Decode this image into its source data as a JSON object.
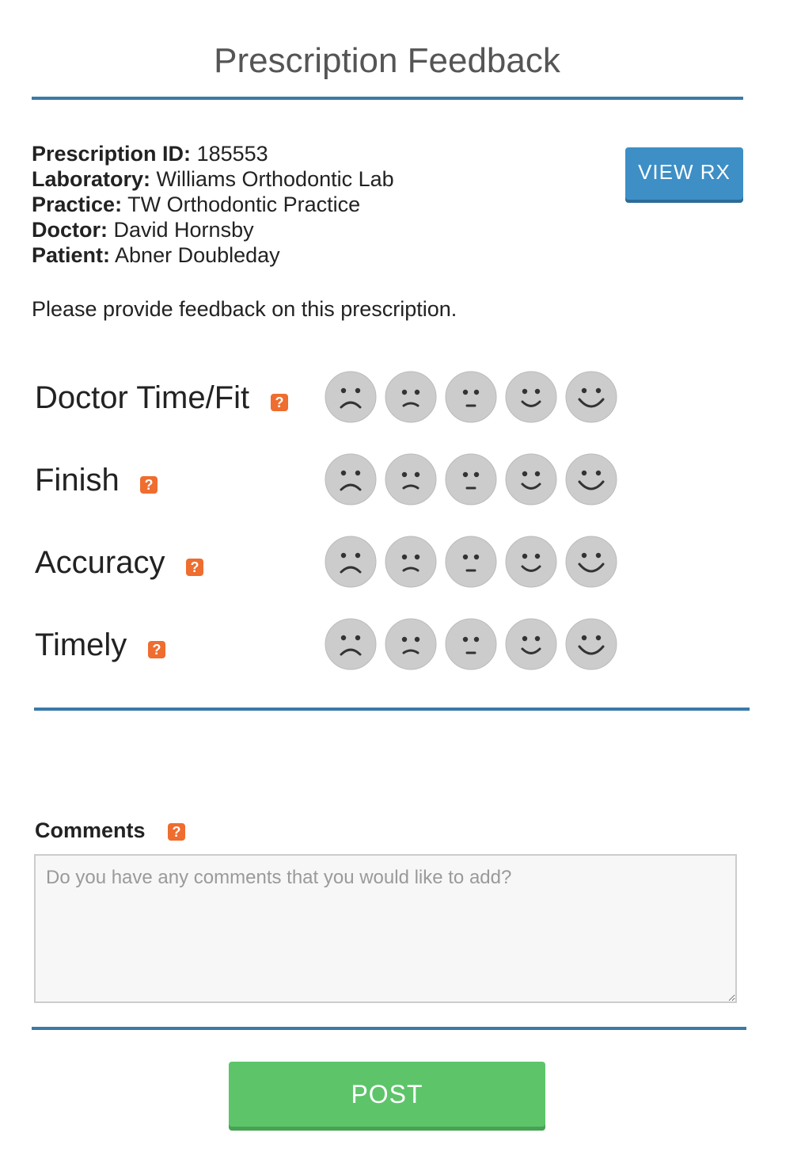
{
  "page": {
    "title": "Prescription Feedback"
  },
  "info": [
    {
      "label": "Prescription ID:",
      "value": "185553"
    },
    {
      "label": "Laboratory:",
      "value": "Williams Orthodontic Lab"
    },
    {
      "label": "Practice:",
      "value": "TW Orthodontic Practice"
    },
    {
      "label": "Doctor:",
      "value": "David Hornsby"
    },
    {
      "label": "Patient:",
      "value": "Abner Doubleday"
    }
  ],
  "view_rx_label": "VIEW RX",
  "prompt": "Please provide feedback on this prescription.",
  "help_glyph": "?",
  "ratings": [
    {
      "label": "Doctor Time/Fit",
      "selected": null
    },
    {
      "label": "Finish",
      "selected": null
    },
    {
      "label": "Accuracy",
      "selected": null
    },
    {
      "label": "Timely",
      "selected": null
    }
  ],
  "face_icons": [
    "very-sad-face-icon",
    "sad-face-icon",
    "neutral-face-icon",
    "happy-face-icon",
    "very-happy-face-icon"
  ],
  "comments": {
    "label": "Comments",
    "placeholder": "Do you have any comments that you would like to add?",
    "value": ""
  },
  "post_label": "POST",
  "colors": {
    "accent_rule": "#3a7aa8",
    "view_rx_button": "#3d8fc6",
    "post_button": "#5dc46a",
    "help_icon": "#ee6d2f",
    "face_fill": "#cccccc"
  }
}
